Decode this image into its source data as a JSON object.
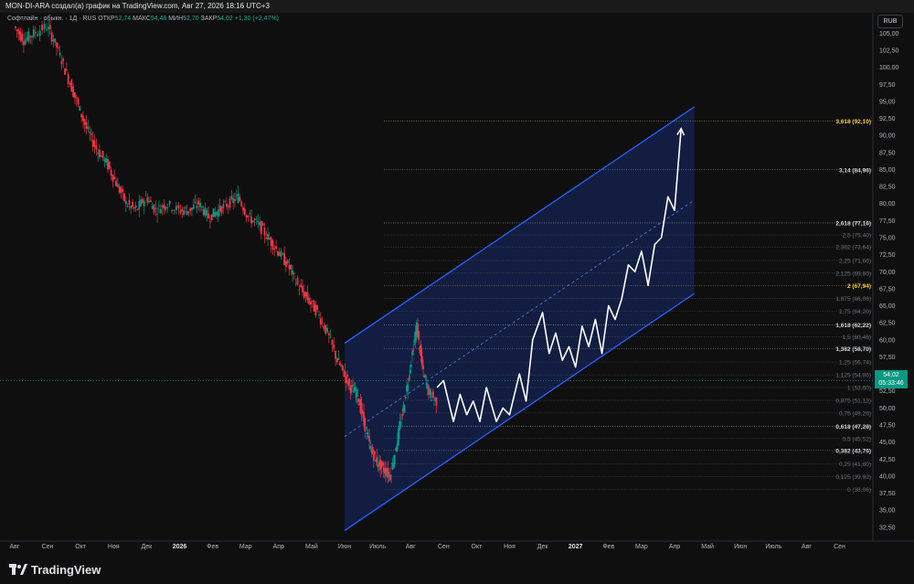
{
  "header": {
    "title": "MON-DI-ARA создал(а) график на TradingView.com, Авг 27, 2026 18:16 UTC+3"
  },
  "legend": {
    "symbol": "Софтлайн · обыкн. · 1Д · RUS",
    "open_label": "ОТКР",
    "open_value": "52,74",
    "high_label": "МАКС",
    "high_value": "54,48",
    "low_label": "МИН",
    "low_value": "52,70",
    "close_label": "ЗАКР",
    "close_value": "54,02",
    "change": "+1,30 (+2,47%)"
  },
  "currency_button": "RUB",
  "price_tag": {
    "price": "54,02",
    "countdown": "05:33:46"
  },
  "brand": "TradingView",
  "colors": {
    "up": "#089981",
    "down": "#f23645",
    "channel": "#2962ff",
    "channel_fill": "#13204a",
    "projection": "#ffffff",
    "fib_highlight": "#f7c948"
  },
  "chart_data": {
    "type": "line",
    "title": "",
    "xlabel": "",
    "ylabel": "",
    "y_axis_ticks": [
      "32,50",
      "35,00",
      "37,50",
      "40,00",
      "42,50",
      "45,00",
      "47,50",
      "50,00",
      "52,50",
      "55,00",
      "57,50",
      "60,00",
      "62,50",
      "65,00",
      "67,50",
      "70,00",
      "72,50",
      "75,00",
      "77,50",
      "80,00",
      "82,50",
      "85,00",
      "87,50",
      "90,00",
      "92,50",
      "95,00",
      "97,50",
      "100,00",
      "102,50",
      "105,00"
    ],
    "ylim": [
      31,
      108
    ],
    "x_axis_labels": [
      "Авг",
      "Сен",
      "Окт",
      "Ноя",
      "Дек",
      "2026",
      "Фев",
      "Мар",
      "Апр",
      "Май",
      "Июн",
      "Июль",
      "Авг",
      "Сен",
      "Окт",
      "Ноя",
      "Дек",
      "2027",
      "Фев",
      "Мар",
      "Апр",
      "Май",
      "Июн",
      "Июль",
      "Авг",
      "Сен"
    ],
    "x_axis_label_positions": [
      0,
      1,
      2,
      3,
      4,
      5,
      6,
      7,
      8,
      9,
      10,
      11,
      12,
      13,
      14,
      15,
      16,
      17,
      18,
      19,
      20,
      21,
      22,
      23,
      24,
      25
    ],
    "fib_levels": [
      {
        "label": "3,618 (92,10)",
        "value": 92.1,
        "style": "gold"
      },
      {
        "label": "3,14 (84,96)",
        "value": 84.96,
        "style": "bold"
      },
      {
        "label": "2,618 (77,16)",
        "value": 77.16,
        "style": "bold"
      },
      {
        "label": "2,5 (75,40)",
        "value": 75.4,
        "style": "dim"
      },
      {
        "label": "2,382 (73,64)",
        "value": 73.64,
        "style": "dim"
      },
      {
        "label": "2,25 (71,66)",
        "value": 71.66,
        "style": "dim"
      },
      {
        "label": "2,125 (69,80)",
        "value": 69.8,
        "style": "dim"
      },
      {
        "label": "2 (67,94)",
        "value": 67.94,
        "style": "gold"
      },
      {
        "label": "1,875 (66,06)",
        "value": 66.06,
        "style": "dim"
      },
      {
        "label": "1,75 (64,20)",
        "value": 64.2,
        "style": "dim"
      },
      {
        "label": "1,618 (62,22)",
        "value": 62.22,
        "style": "bold"
      },
      {
        "label": "1,5 (60,46)",
        "value": 60.46,
        "style": "dim"
      },
      {
        "label": "1,382 (58,70)",
        "value": 58.7,
        "style": "bold"
      },
      {
        "label": "1,25 (56,74)",
        "value": 56.74,
        "style": "dim"
      },
      {
        "label": "1,125 (54,86)",
        "value": 54.86,
        "style": "dim"
      },
      {
        "label": "1 (53,00)",
        "value": 53.0,
        "style": "dim"
      },
      {
        "label": "0,875 (51,12)",
        "value": 51.12,
        "style": "dim"
      },
      {
        "label": "0,75 (49,26)",
        "value": 49.26,
        "style": "dim"
      },
      {
        "label": "0,618 (47,28)",
        "value": 47.28,
        "style": "bold"
      },
      {
        "label": "0,5 (45,52)",
        "value": 45.52,
        "style": "dim"
      },
      {
        "label": "0,382 (43,76)",
        "value": 43.76,
        "style": "bold"
      },
      {
        "label": "0,25 (41,80)",
        "value": 41.8,
        "style": "dim"
      },
      {
        "label": "0,125 (39,92)",
        "value": 39.92,
        "style": "dim"
      },
      {
        "label": "0 (38,06)",
        "value": 38.06,
        "style": "dim"
      }
    ],
    "price_series": {
      "x": [
        0,
        0.3,
        0.6,
        1.0,
        1.3,
        1.6,
        1.9,
        2.2,
        2.5,
        2.8,
        3.1,
        3.4,
        3.7,
        4.0,
        4.3,
        4.6,
        5.0,
        5.3,
        5.6,
        5.9,
        6.2,
        6.5,
        6.8,
        7.1,
        7.4,
        7.7,
        8.0,
        8.3,
        8.6,
        8.9,
        9.2,
        9.5,
        9.8,
        10.0,
        10.2,
        10.4,
        10.6,
        10.8,
        11.0,
        11.2,
        11.4,
        11.6,
        11.8,
        12.0,
        12.2,
        12.4,
        12.6,
        12.8
      ],
      "values": [
        106,
        104,
        105,
        106,
        103,
        99,
        95,
        91,
        88,
        86,
        83,
        80,
        79,
        81,
        79,
        80,
        79,
        79,
        80,
        78,
        79,
        80,
        81,
        78,
        77,
        75,
        73,
        71,
        68,
        66,
        64,
        61,
        57,
        55,
        53,
        52,
        48,
        44,
        42,
        41,
        40,
        45,
        50,
        56,
        62,
        55,
        52,
        51
      ]
    },
    "projection": {
      "x": [
        12.8,
        13.0,
        13.3,
        13.5,
        13.7,
        13.9,
        14.1,
        14.3,
        14.6,
        14.8,
        15.0,
        15.3,
        15.5,
        15.7,
        16.0,
        16.2,
        16.4,
        16.6,
        16.8,
        17.0,
        17.2,
        17.4,
        17.6,
        17.8,
        18.0,
        18.2,
        18.4,
        18.6,
        18.8,
        19.0,
        19.2,
        19.4,
        19.6,
        19.8,
        20.0,
        20.2
      ],
      "values": [
        53,
        54,
        48,
        52,
        49,
        51,
        48,
        53,
        48,
        50,
        49,
        55,
        51,
        60,
        64,
        58,
        61,
        57,
        59,
        56,
        62,
        59,
        63,
        58,
        65,
        63,
        66,
        71,
        70,
        73,
        68,
        74,
        75,
        81,
        79,
        91
      ]
    },
    "channel": {
      "upper": {
        "x": [
          10.0,
          20.6
        ],
        "values": [
          59.5,
          94.2
        ]
      },
      "lower": {
        "x": [
          10.0,
          20.6
        ],
        "values": [
          32.0,
          66.8
        ]
      },
      "median": {
        "x": [
          10.0,
          20.6
        ],
        "values": [
          45.8,
          80.5
        ]
      }
    },
    "current_price": 54.02,
    "grid": false,
    "legend_position": "top-left"
  }
}
